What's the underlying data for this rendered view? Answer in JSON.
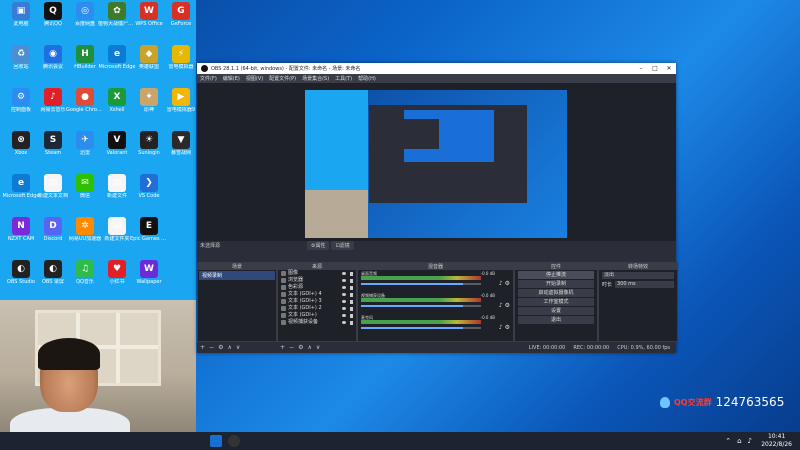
{
  "desktop_icons": [
    {
      "label": "此电脑",
      "color": "#3a7bd5",
      "glyph": "▣"
    },
    {
      "label": "腾讯QQ",
      "color": "#111111",
      "glyph": "Q"
    },
    {
      "label": "百度网盘",
      "color": "#2d8cf0",
      "glyph": "◎"
    },
    {
      "label": "植物大战僵尸杂交版",
      "color": "#3d7a2a",
      "glyph": "✿"
    },
    {
      "label": "WPS Office",
      "color": "#d93025",
      "glyph": "W"
    },
    {
      "label": "GeForce",
      "color": "#d93025",
      "glyph": "G"
    },
    {
      "label": "回收站",
      "color": "#4a8fd4",
      "glyph": "♻"
    },
    {
      "label": "腾讯会议",
      "color": "#1e6fe0",
      "glyph": "◉"
    },
    {
      "label": "HBuilder",
      "color": "#1f8f3a",
      "glyph": "H"
    },
    {
      "label": "Microsoft Edge",
      "color": "#0c7bd6",
      "glyph": "e"
    },
    {
      "label": "英雄联盟",
      "color": "#c9a227",
      "glyph": "◆"
    },
    {
      "label": "雷电模拟器",
      "color": "#e6b800",
      "glyph": "⚡"
    },
    {
      "label": "控制面板",
      "color": "#2d8cf0",
      "glyph": "⚙"
    },
    {
      "label": "网易云音乐",
      "color": "#e21f26",
      "glyph": "♪"
    },
    {
      "label": "Google Chrome",
      "color": "#dd4b39",
      "glyph": "●"
    },
    {
      "label": "Xshell",
      "color": "#1b9a3a",
      "glyph": "X"
    },
    {
      "label": "原神",
      "color": "#caa56a",
      "glyph": "✦"
    },
    {
      "label": "雷电模拟器9",
      "color": "#f2b705",
      "glyph": "▶"
    },
    {
      "label": "Xbox",
      "color": "#222222",
      "glyph": "⊗"
    },
    {
      "label": "Steam",
      "color": "#1b2838",
      "glyph": "S"
    },
    {
      "label": "迅雷",
      "color": "#2d8cf0",
      "glyph": "✈"
    },
    {
      "label": "Valorant",
      "color": "#111111",
      "glyph": "V"
    },
    {
      "label": "Sunlogin",
      "color": "#222222",
      "glyph": "☀"
    },
    {
      "label": "暴雪战网",
      "color": "#2a2a2a",
      "glyph": "▼"
    },
    {
      "label": "Microsoft Edge",
      "color": "#0c7bd6",
      "glyph": "e"
    },
    {
      "label": "新建文本文档",
      "color": "#f5f5f5",
      "glyph": "▤"
    },
    {
      "label": "微信",
      "color": "#2dc100",
      "glyph": "✉"
    },
    {
      "label": "新建文件",
      "color": "#f5f5f5",
      "glyph": "▤"
    },
    {
      "label": "VS Code",
      "color": "#1f6fd6",
      "glyph": "❯"
    },
    {
      "label": "",
      "color": "transparent",
      "glyph": ""
    },
    {
      "label": "NZXT CAM",
      "color": "#7a2bd9",
      "glyph": "N"
    },
    {
      "label": "Discord",
      "color": "#5865f2",
      "glyph": "D"
    },
    {
      "label": "网易UU加速器",
      "color": "#ff8a00",
      "glyph": "✲"
    },
    {
      "label": "新建文件夹",
      "color": "#f5f5f5",
      "glyph": "▤"
    },
    {
      "label": "Epic Games Launcher",
      "color": "#111111",
      "glyph": "E"
    },
    {
      "label": "",
      "color": "transparent",
      "glyph": ""
    },
    {
      "label": "OBS Studio",
      "color": "#222222",
      "glyph": "◐"
    },
    {
      "label": "OBS 录屏",
      "color": "#222222",
      "glyph": "◐"
    },
    {
      "label": "QQ音乐",
      "color": "#2dbb4b",
      "glyph": "♫"
    },
    {
      "label": "小红书",
      "color": "#e21f26",
      "glyph": "♥"
    },
    {
      "label": "Wallpaper",
      "color": "#6c2bd9",
      "glyph": "W"
    },
    {
      "label": "",
      "color": "transparent",
      "glyph": ""
    }
  ],
  "obs": {
    "title": "OBS 28.1.1 (64-bit, windows) - 配置文件: 未命名 - 场景: 未命名",
    "menu": [
      "文件(F)",
      "编辑(E)",
      "视图(V)",
      "配置文件(P)",
      "场景集合(S)",
      "工具(T)",
      "帮助(H)"
    ],
    "scene_label": "未选择源",
    "tabs": [
      "⚙属性",
      "⊡滤镜"
    ],
    "panels": {
      "scenes": "场景",
      "sources": "来源",
      "mixer": "混音器",
      "controls": "控件",
      "transitions": "转场特效"
    },
    "scenes": [
      "视频录制"
    ],
    "sources": [
      "图像",
      "浏览器",
      "色彩源",
      "文本 (GDI+) 4",
      "文本 (GDI+) 3",
      "文本 (GDI+) 2",
      "文本 (GDI+)",
      "视频捕获设备"
    ],
    "mixer": [
      {
        "name": "桌面音频",
        "db": "-0.0 dB",
        "fill": 0.85
      },
      {
        "name": "视频捕获设备",
        "db": "-0.0 dB",
        "fill": 0.85
      },
      {
        "name": "麦克风",
        "db": "-0.0 dB",
        "fill": 0.85
      }
    ],
    "controls": [
      "停止推流",
      "开始录制",
      "启动虚拟摄像机",
      "工作室模式",
      "设置",
      "退出"
    ],
    "transition": {
      "name": "淡出",
      "duration_label": "时长",
      "duration": "300 ms"
    },
    "status": [
      "LIVE: 00:00:00",
      "REC: 00:00:00",
      "CPU: 0.9%, 60.00 fps"
    ],
    "bottom_btns": [
      "+",
      "−",
      "⚙",
      "∧",
      "∨"
    ]
  },
  "overlay": {
    "qq_label": "QQ交流群",
    "qq_number": "124763565"
  },
  "taskbar": {
    "time": "10:41",
    "date": "2022/8/26"
  }
}
